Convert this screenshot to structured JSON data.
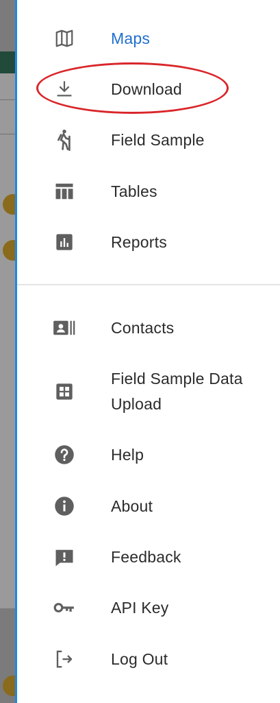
{
  "nav": {
    "primary": [
      {
        "id": "maps",
        "label": "Maps",
        "icon": "map-icon",
        "active": true
      },
      {
        "id": "download",
        "label": "Download",
        "icon": "download-icon",
        "active": false
      },
      {
        "id": "field-sample",
        "label": "Field Sample",
        "icon": "hiker-icon",
        "active": false
      },
      {
        "id": "tables",
        "label": "Tables",
        "icon": "table-icon",
        "active": false
      },
      {
        "id": "reports",
        "label": "Reports",
        "icon": "bar-chart-icon",
        "active": false
      }
    ],
    "secondary": [
      {
        "id": "contacts",
        "label": "Contacts",
        "icon": "contact-card-icon"
      },
      {
        "id": "field-sample-data-upload",
        "label": "Field Sample Data Upload",
        "icon": "grid-icon"
      },
      {
        "id": "help",
        "label": "Help",
        "icon": "help-icon"
      },
      {
        "id": "about",
        "label": "About",
        "icon": "info-icon"
      },
      {
        "id": "feedback",
        "label": "Feedback",
        "icon": "feedback-icon"
      },
      {
        "id": "api-key",
        "label": "API Key",
        "icon": "key-icon"
      },
      {
        "id": "log-out",
        "label": "Log Out",
        "icon": "logout-icon"
      }
    ]
  },
  "colors": {
    "active": "#1f6fcf",
    "text": "#2b2b2b",
    "icon": "#5f5f5f",
    "drawer_edge": "#1e88e5",
    "annotation": "#d9262a"
  }
}
